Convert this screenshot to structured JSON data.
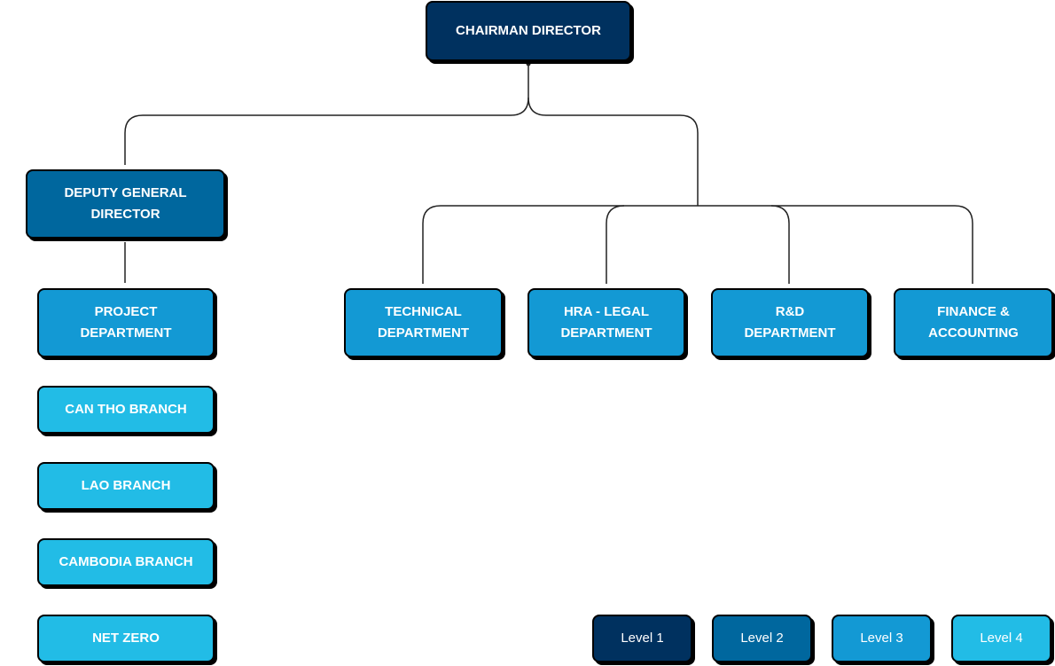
{
  "colors": {
    "level1": "#00315f",
    "level2": "#00679e",
    "level3": "#1399d4",
    "level4": "#22bce6"
  },
  "nodes": {
    "chairman": "CHAIRMAN DIRECTOR",
    "deputy": "DEPUTY GENERAL DIRECTOR",
    "project": "PROJECT DEPARTMENT",
    "technical": "TECHNICAL DEPARTMENT",
    "hra": "HRA - LEGAL DEPARTMENT",
    "rnd": "R&D DEPARTMENT",
    "finance": "FINANCE & ACCOUNTING",
    "cantho": "CAN THO BRANCH",
    "lao": "LAO BRANCH",
    "cambodia": "CAMBODIA BRANCH",
    "netzero": "NET ZERO"
  },
  "legend": [
    "Level 1",
    "Level 2",
    "Level 3",
    "Level 4"
  ]
}
